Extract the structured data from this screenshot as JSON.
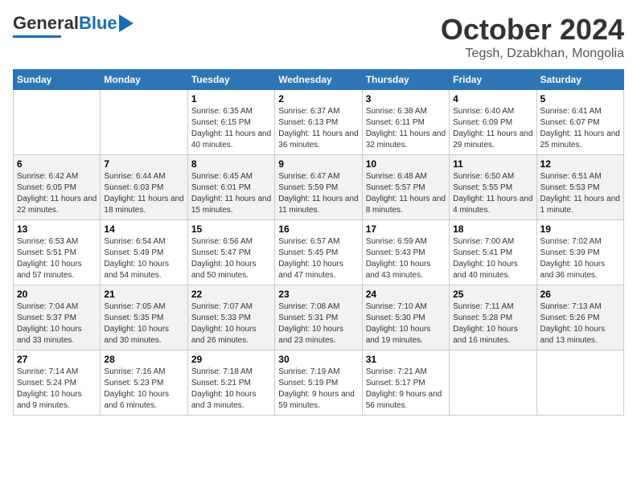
{
  "header": {
    "logo_text1": "General",
    "logo_text2": "Blue",
    "title": "October 2024",
    "subtitle": "Tegsh, Dzabkhan, Mongolia"
  },
  "weekdays": [
    "Sunday",
    "Monday",
    "Tuesday",
    "Wednesday",
    "Thursday",
    "Friday",
    "Saturday"
  ],
  "rows": [
    [
      {
        "day": "",
        "info": ""
      },
      {
        "day": "",
        "info": ""
      },
      {
        "day": "1",
        "info": "Sunrise: 6:35 AM\nSunset: 6:15 PM\nDaylight: 11 hours and 40 minutes."
      },
      {
        "day": "2",
        "info": "Sunrise: 6:37 AM\nSunset: 6:13 PM\nDaylight: 11 hours and 36 minutes."
      },
      {
        "day": "3",
        "info": "Sunrise: 6:38 AM\nSunset: 6:11 PM\nDaylight: 11 hours and 32 minutes."
      },
      {
        "day": "4",
        "info": "Sunrise: 6:40 AM\nSunset: 6:09 PM\nDaylight: 11 hours and 29 minutes."
      },
      {
        "day": "5",
        "info": "Sunrise: 6:41 AM\nSunset: 6:07 PM\nDaylight: 11 hours and 25 minutes."
      }
    ],
    [
      {
        "day": "6",
        "info": "Sunrise: 6:42 AM\nSunset: 6:05 PM\nDaylight: 11 hours and 22 minutes."
      },
      {
        "day": "7",
        "info": "Sunrise: 6:44 AM\nSunset: 6:03 PM\nDaylight: 11 hours and 18 minutes."
      },
      {
        "day": "8",
        "info": "Sunrise: 6:45 AM\nSunset: 6:01 PM\nDaylight: 11 hours and 15 minutes."
      },
      {
        "day": "9",
        "info": "Sunrise: 6:47 AM\nSunset: 5:59 PM\nDaylight: 11 hours and 11 minutes."
      },
      {
        "day": "10",
        "info": "Sunrise: 6:48 AM\nSunset: 5:57 PM\nDaylight: 11 hours and 8 minutes."
      },
      {
        "day": "11",
        "info": "Sunrise: 6:50 AM\nSunset: 5:55 PM\nDaylight: 11 hours and 4 minutes."
      },
      {
        "day": "12",
        "info": "Sunrise: 6:51 AM\nSunset: 5:53 PM\nDaylight: 11 hours and 1 minute."
      }
    ],
    [
      {
        "day": "13",
        "info": "Sunrise: 6:53 AM\nSunset: 5:51 PM\nDaylight: 10 hours and 57 minutes."
      },
      {
        "day": "14",
        "info": "Sunrise: 6:54 AM\nSunset: 5:49 PM\nDaylight: 10 hours and 54 minutes."
      },
      {
        "day": "15",
        "info": "Sunrise: 6:56 AM\nSunset: 5:47 PM\nDaylight: 10 hours and 50 minutes."
      },
      {
        "day": "16",
        "info": "Sunrise: 6:57 AM\nSunset: 5:45 PM\nDaylight: 10 hours and 47 minutes."
      },
      {
        "day": "17",
        "info": "Sunrise: 6:59 AM\nSunset: 5:43 PM\nDaylight: 10 hours and 43 minutes."
      },
      {
        "day": "18",
        "info": "Sunrise: 7:00 AM\nSunset: 5:41 PM\nDaylight: 10 hours and 40 minutes."
      },
      {
        "day": "19",
        "info": "Sunrise: 7:02 AM\nSunset: 5:39 PM\nDaylight: 10 hours and 36 minutes."
      }
    ],
    [
      {
        "day": "20",
        "info": "Sunrise: 7:04 AM\nSunset: 5:37 PM\nDaylight: 10 hours and 33 minutes."
      },
      {
        "day": "21",
        "info": "Sunrise: 7:05 AM\nSunset: 5:35 PM\nDaylight: 10 hours and 30 minutes."
      },
      {
        "day": "22",
        "info": "Sunrise: 7:07 AM\nSunset: 5:33 PM\nDaylight: 10 hours and 26 minutes."
      },
      {
        "day": "23",
        "info": "Sunrise: 7:08 AM\nSunset: 5:31 PM\nDaylight: 10 hours and 23 minutes."
      },
      {
        "day": "24",
        "info": "Sunrise: 7:10 AM\nSunset: 5:30 PM\nDaylight: 10 hours and 19 minutes."
      },
      {
        "day": "25",
        "info": "Sunrise: 7:11 AM\nSunset: 5:28 PM\nDaylight: 10 hours and 16 minutes."
      },
      {
        "day": "26",
        "info": "Sunrise: 7:13 AM\nSunset: 5:26 PM\nDaylight: 10 hours and 13 minutes."
      }
    ],
    [
      {
        "day": "27",
        "info": "Sunrise: 7:14 AM\nSunset: 5:24 PM\nDaylight: 10 hours and 9 minutes."
      },
      {
        "day": "28",
        "info": "Sunrise: 7:16 AM\nSunset: 5:23 PM\nDaylight: 10 hours and 6 minutes."
      },
      {
        "day": "29",
        "info": "Sunrise: 7:18 AM\nSunset: 5:21 PM\nDaylight: 10 hours and 3 minutes."
      },
      {
        "day": "30",
        "info": "Sunrise: 7:19 AM\nSunset: 5:19 PM\nDaylight: 9 hours and 59 minutes."
      },
      {
        "day": "31",
        "info": "Sunrise: 7:21 AM\nSunset: 5:17 PM\nDaylight: 9 hours and 56 minutes."
      },
      {
        "day": "",
        "info": ""
      },
      {
        "day": "",
        "info": ""
      }
    ]
  ]
}
